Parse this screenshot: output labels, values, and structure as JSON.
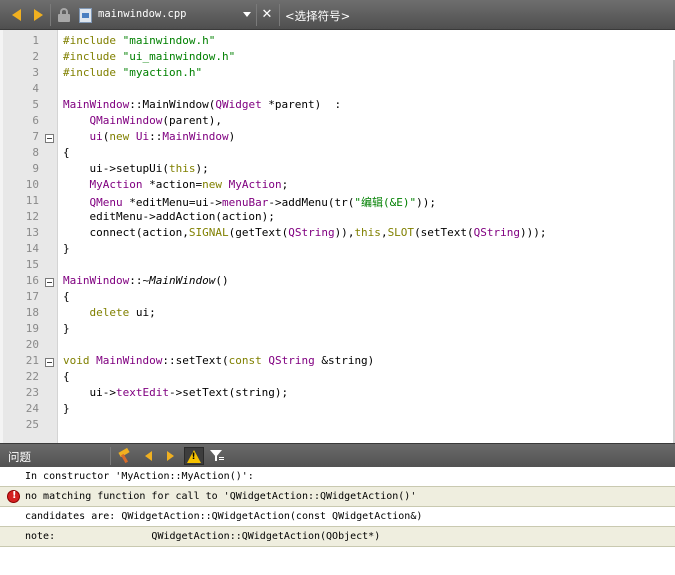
{
  "toolbar": {
    "filename": "mainwindow.cpp",
    "symbol_selector": "<选择符号>",
    "close_label": "✕"
  },
  "editor": {
    "line_numbers": [
      "1",
      "2",
      "3",
      "4",
      "5",
      "6",
      "7",
      "8",
      "9",
      "10",
      "11",
      "12",
      "13",
      "14",
      "15",
      "16",
      "17",
      "18",
      "19",
      "20",
      "21",
      "22",
      "23",
      "24",
      "25"
    ]
  },
  "issues": {
    "title": "问题",
    "items": [
      {
        "text": "In constructor 'MyAction::MyAction()':",
        "error": false
      },
      {
        "text": "no matching function for call to 'QWidgetAction::QWidgetAction()'",
        "error": true
      },
      {
        "text": "candidates are: QWidgetAction::QWidgetAction(const QWidgetAction&)",
        "error": false
      },
      {
        "text": "note:                QWidgetAction::QWidgetAction(QObject*)",
        "error": false
      }
    ]
  },
  "colors": {
    "keyword": "#808000",
    "string": "#008000",
    "type": "#800080",
    "toolbar": "#5a5a5a",
    "error": "#d42020"
  }
}
